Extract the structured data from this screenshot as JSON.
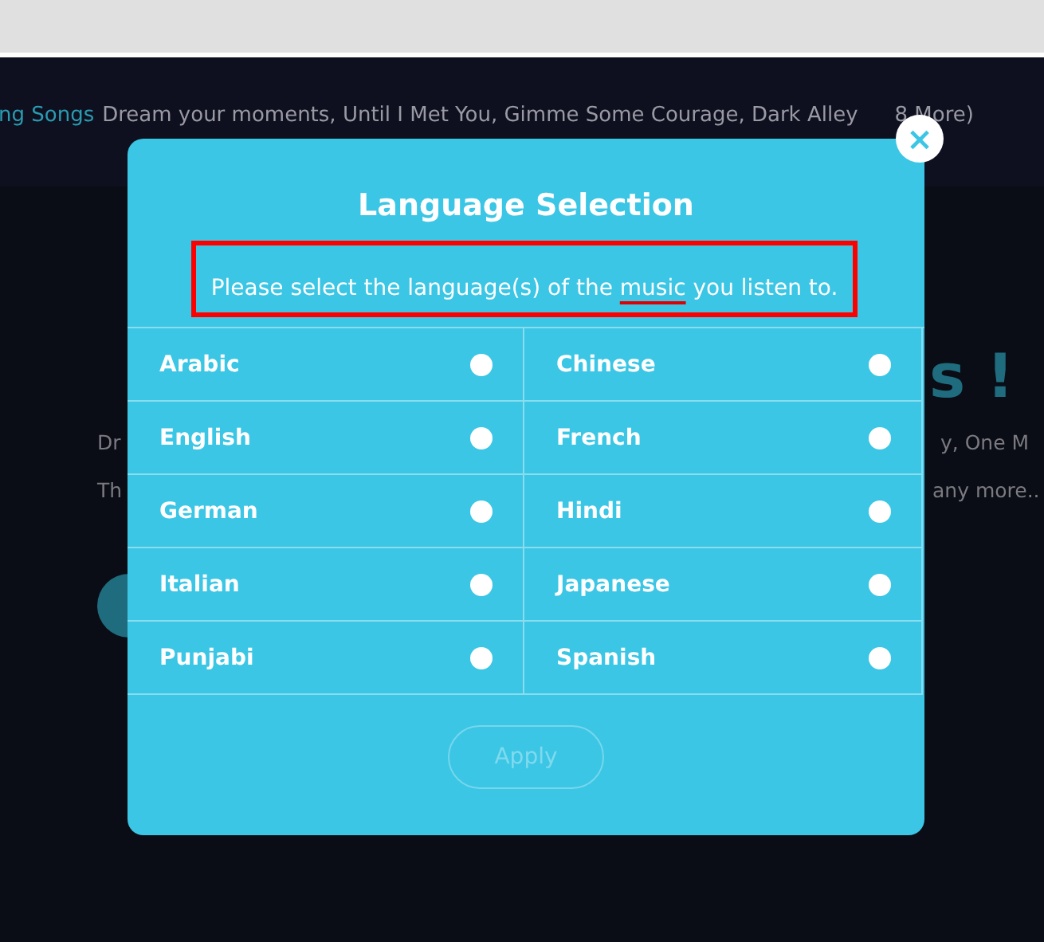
{
  "page": {
    "now_playing_label": "ng Songs",
    "now_playing_songs": "Dream your moments, Until I Met You, Gimme Some Courage, Dark Alley",
    "more_count": "8 More)",
    "hero": [
      {
        "kind": "heading"
      },
      {
        "right": "s !",
        "kind": "accent"
      },
      {
        "left": "Dr",
        "right": "y, One M",
        "kind": "body"
      },
      {
        "left": "Th",
        "right": "any more..",
        "kind": "body"
      }
    ]
  },
  "modal": {
    "close": "×",
    "title": "Language Selection",
    "instruction": {
      "before": "Please select the language(s) of the ",
      "underlined": "music",
      "after": " you listen to."
    },
    "languages": [
      {
        "label": "Arabic",
        "selected": false
      },
      {
        "label": "Chinese",
        "selected": false
      },
      {
        "label": "English",
        "selected": false
      },
      {
        "label": "French",
        "selected": false
      },
      {
        "label": "German",
        "selected": false
      },
      {
        "label": "Hindi",
        "selected": false
      },
      {
        "label": "Italian",
        "selected": false
      },
      {
        "label": "Japanese",
        "selected": false
      },
      {
        "label": "Punjabi",
        "selected": false
      },
      {
        "label": "Spanish",
        "selected": false
      }
    ],
    "apply": {
      "label": "Apply",
      "disabled": true
    }
  }
}
